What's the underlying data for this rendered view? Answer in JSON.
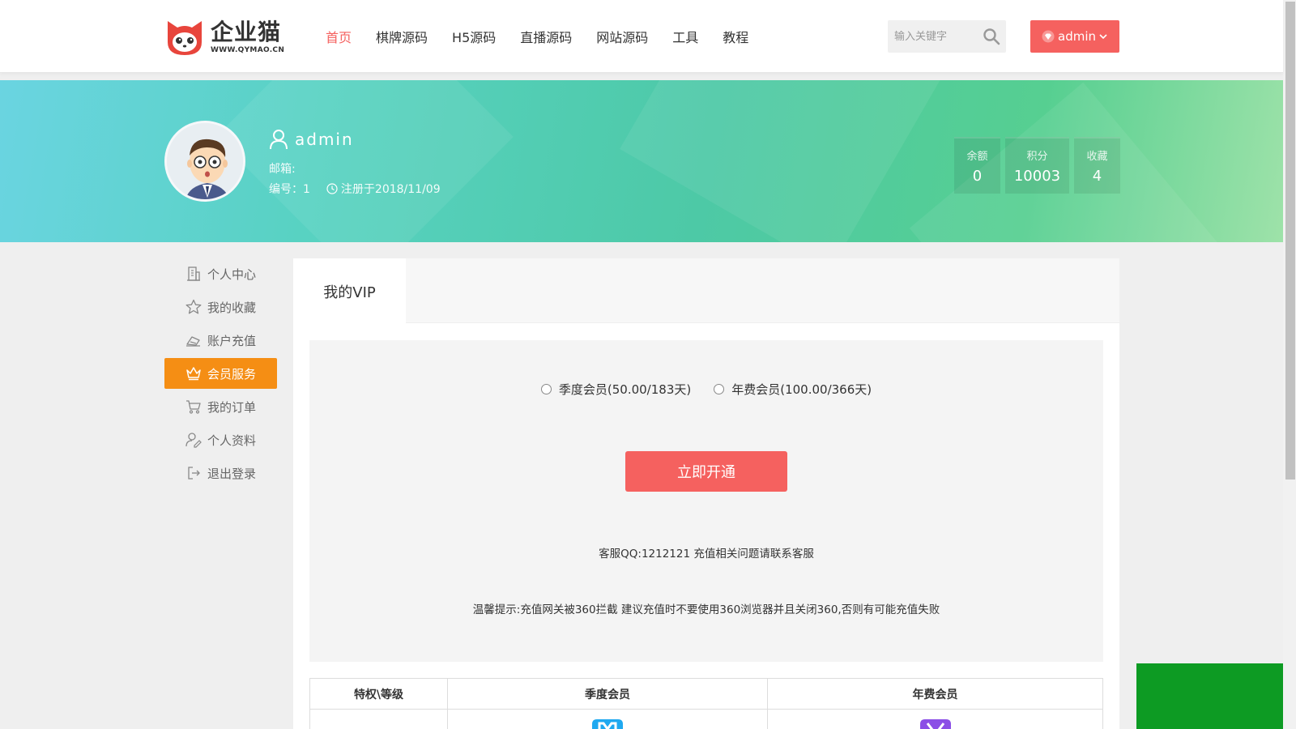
{
  "header": {
    "logo_text": "企业猫",
    "logo_sub": "WWW.QYMAO.CN",
    "nav": [
      {
        "label": "首页",
        "active": true
      },
      {
        "label": "棋牌源码",
        "active": false
      },
      {
        "label": "H5源码",
        "active": false
      },
      {
        "label": "直播源码",
        "active": false
      },
      {
        "label": "网站源码",
        "active": false
      },
      {
        "label": "工具",
        "active": false
      },
      {
        "label": "教程",
        "active": false
      }
    ],
    "search_placeholder": "输入关键字",
    "user_label": "admin"
  },
  "profile": {
    "username": "admin",
    "email_label": "邮箱:",
    "id_text": "编号：1",
    "registered_text": "注册于2018/11/09",
    "stats": [
      {
        "label": "余额",
        "value": "0"
      },
      {
        "label": "积分",
        "value": "10003"
      },
      {
        "label": "收藏",
        "value": "4"
      }
    ]
  },
  "sidebar": {
    "items": [
      {
        "label": "个人中心",
        "icon": "building-icon",
        "active": false
      },
      {
        "label": "我的收藏",
        "icon": "star-icon",
        "active": false
      },
      {
        "label": "账户充值",
        "icon": "recharge-icon",
        "active": false
      },
      {
        "label": "会员服务",
        "icon": "crown-icon",
        "active": true
      },
      {
        "label": "我的订单",
        "icon": "cart-icon",
        "active": false
      },
      {
        "label": "个人资料",
        "icon": "user-edit-icon",
        "active": false
      },
      {
        "label": "退出登录",
        "icon": "logout-icon",
        "active": false
      }
    ]
  },
  "main": {
    "tab_label": "我的VIP",
    "options": [
      {
        "label": "季度会员(50.00/183天)",
        "selected": false
      },
      {
        "label": "年费会员(100.00/366天)",
        "selected": false
      }
    ],
    "open_button": "立即开通",
    "qq_text": "客服QQ:1212121 充值相关问题请联系客服",
    "tip_text": "温馨提示:充值网关被360拦截 建议充值时不要使用360浏览器并且关闭360,否则有可能充值失败",
    "table_headers": [
      "特权\\等级",
      "季度会员",
      "年费会员"
    ]
  },
  "colors": {
    "accent": "#f5615f",
    "sidebar_active": "#f58e14",
    "badge_quarter": "#1fa9f0",
    "badge_year": "#8b4ee6",
    "green_block": "#0d9b23"
  }
}
